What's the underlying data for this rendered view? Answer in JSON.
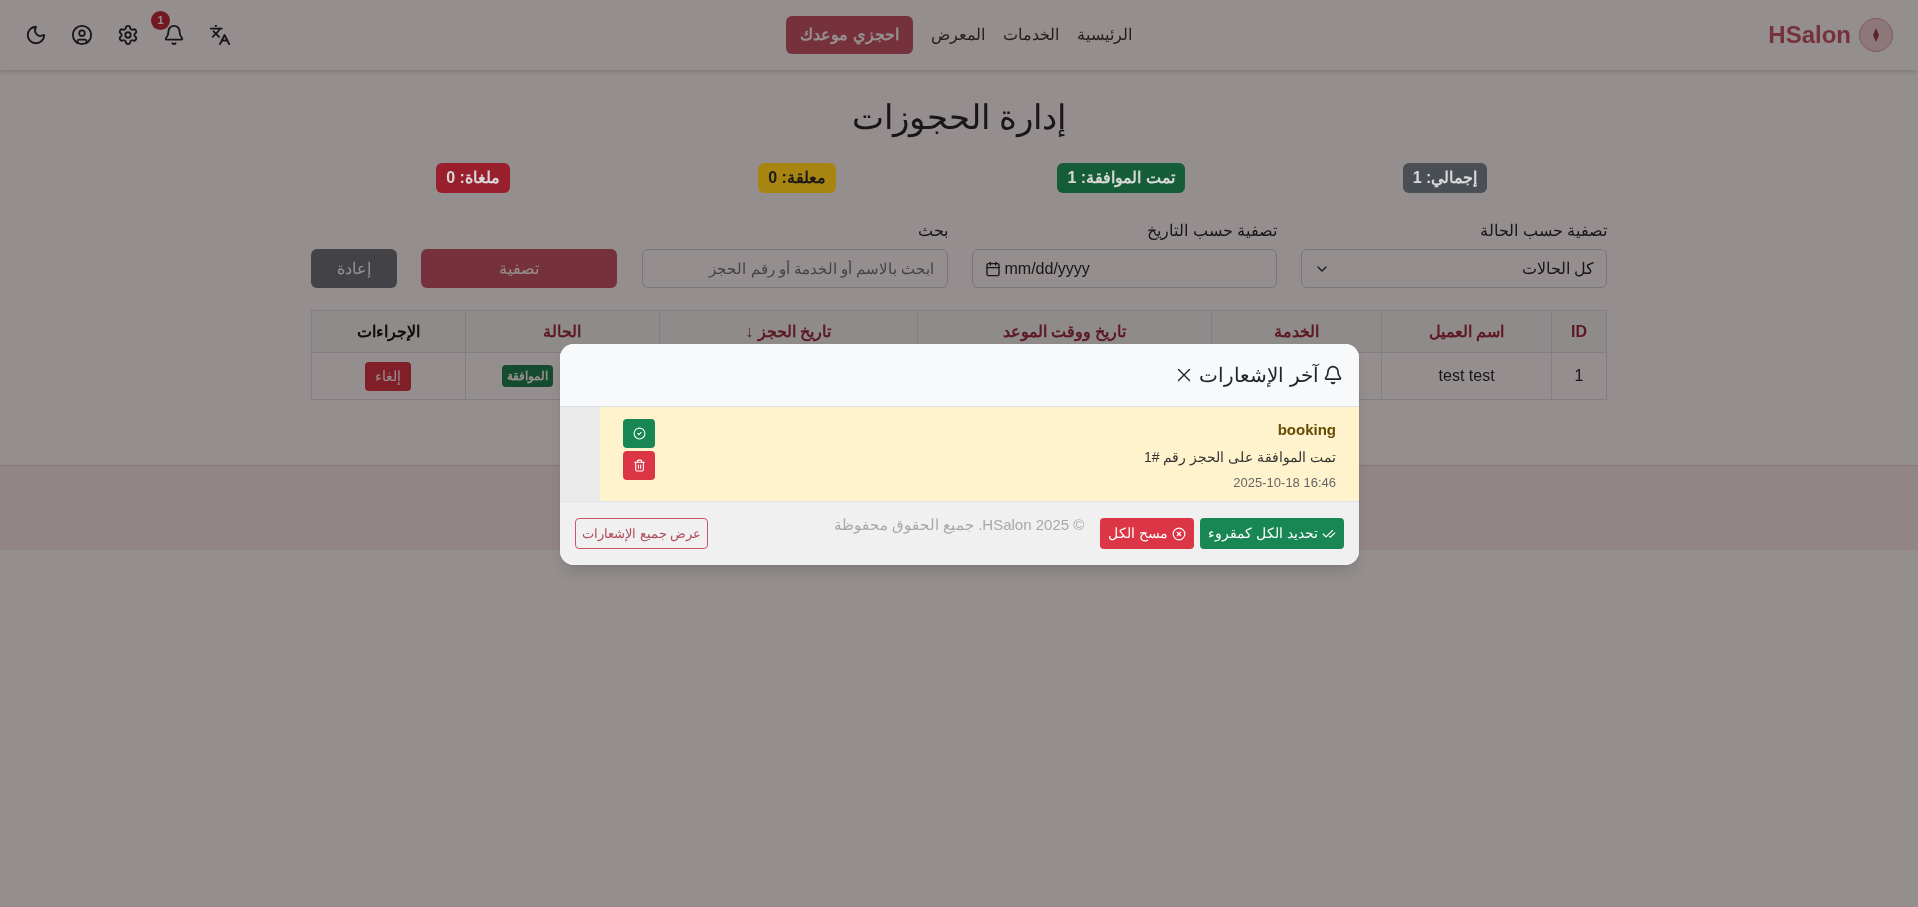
{
  "navbar": {
    "brand": "HSalon",
    "links": [
      {
        "label": "الرئيسية"
      },
      {
        "label": "الخدمات"
      },
      {
        "label": "المعرض"
      }
    ],
    "cta": "احجزي موعدك",
    "notification_count": "1"
  },
  "page": {
    "title": "إدارة الحجوزات",
    "stats": [
      {
        "label": "إجمالي: 1",
        "color": "#4a4f55"
      },
      {
        "label": "تمت الموافقة: 1",
        "color": "#155c39"
      },
      {
        "label": "معلقة: 0",
        "color": "#a88410"
      },
      {
        "label": "ملغاة: 0",
        "color": "#9a1f2c"
      }
    ],
    "filters": {
      "status_label": "تصفية حسب الحالة",
      "status_value": "كل الحالات",
      "date_label": "تصفية حسب التاريخ",
      "date_placeholder": "mm/dd/yyyy",
      "search_label": "بحث",
      "search_placeholder": "ابحث بالاسم أو الخدمة أو رقم الحجز",
      "filter_button": "تصفية",
      "reset_button": "إعادة"
    },
    "table": {
      "columns": [
        "ID",
        "اسم العميل",
        "الخدمة",
        "تاريخ ووقت الموعد",
        "تاريخ الحجز ↓",
        "الحالة",
        "الإجراءات"
      ],
      "rows": [
        {
          "id": "1",
          "customer": "test test",
          "status": "الموافقة",
          "action": "إلغاء"
        }
      ]
    }
  },
  "footer": {
    "copyright": "© HSalon 2025. جميع الحقوق محفوظة"
  },
  "modal": {
    "title": "آخر الإشعارات",
    "notifications": [
      {
        "title": "booking",
        "message": "تمت الموافقة على الحجز رقم #1",
        "time": "2025-10-18 16:46",
        "read": false
      }
    ],
    "buttons": {
      "mark_all": "تحديد الكل كمقروء",
      "clear_all": "مسح الكل",
      "view_all": "عرض جميع الإشعارات"
    }
  }
}
